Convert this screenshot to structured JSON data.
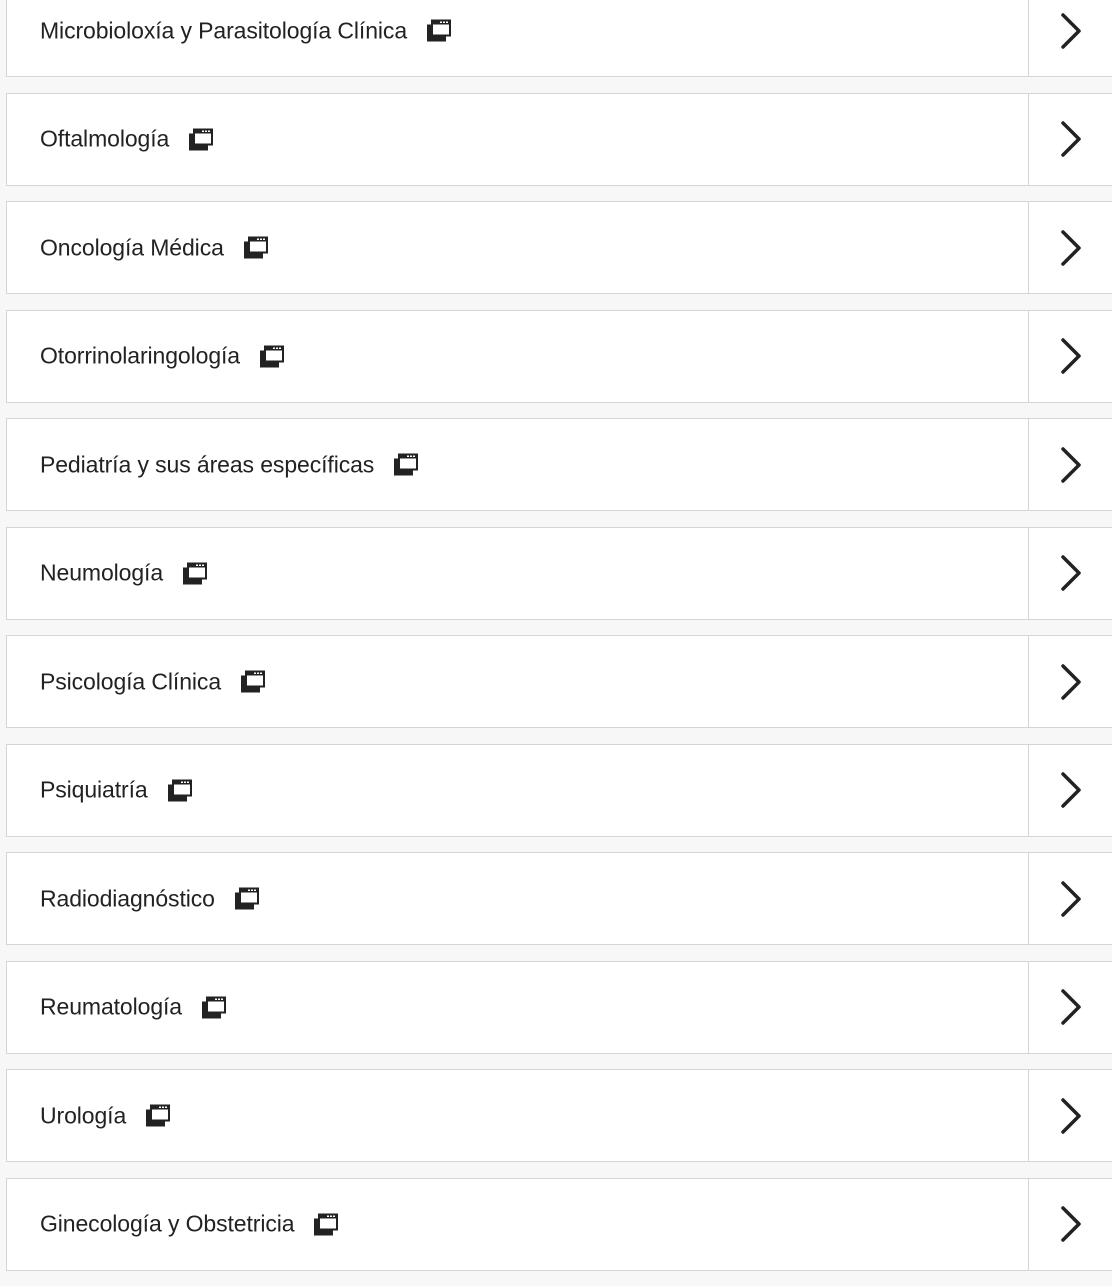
{
  "list": {
    "items": [
      {
        "label": "Microbioloxía y Parasitología Clínica",
        "icon": "new-window-icon",
        "chevron": "chevron-right-icon"
      },
      {
        "label": "Oftalmología",
        "icon": "new-window-icon",
        "chevron": "chevron-right-icon"
      },
      {
        "label": "Oncología Médica",
        "icon": "new-window-icon",
        "chevron": "chevron-right-icon"
      },
      {
        "label": "Otorrinolaringología",
        "icon": "new-window-icon",
        "chevron": "chevron-right-icon"
      },
      {
        "label": "Pediatría y sus áreas específicas",
        "icon": "new-window-icon",
        "chevron": "chevron-right-icon"
      },
      {
        "label": "Neumología",
        "icon": "new-window-icon",
        "chevron": "chevron-right-icon"
      },
      {
        "label": "Psicología Clínica",
        "icon": "new-window-icon",
        "chevron": "chevron-right-icon"
      },
      {
        "label": "Psiquiatría",
        "icon": "new-window-icon",
        "chevron": "chevron-right-icon"
      },
      {
        "label": "Radiodiagnóstico",
        "icon": "new-window-icon",
        "chevron": "chevron-right-icon"
      },
      {
        "label": "Reumatología",
        "icon": "new-window-icon",
        "chevron": "chevron-right-icon"
      },
      {
        "label": "Urología",
        "icon": "new-window-icon",
        "chevron": "chevron-right-icon"
      },
      {
        "label": "Ginecología y Obstetricia",
        "icon": "new-window-icon",
        "chevron": "chevron-right-icon"
      }
    ]
  },
  "colors": {
    "background": "#f7f7f7",
    "row_background": "#ffffff",
    "border": "#d5d5d5",
    "text": "#222222",
    "icon": "#222222"
  }
}
